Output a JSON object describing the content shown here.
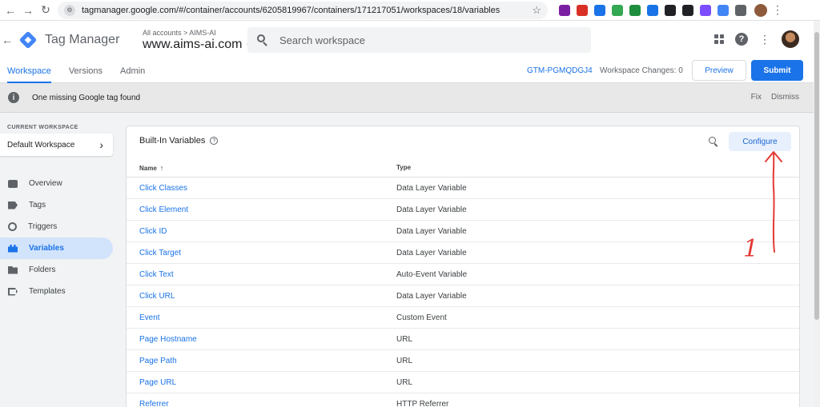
{
  "browser": {
    "url": "tagmanager.google.com/#/container/accounts/6205819967/containers/171217051/workspaces/18/variables",
    "extensions": [
      "#7b1fa2",
      "#d93025",
      "#1a73e8",
      "#34a853",
      "#1e8e3e",
      "#1a73e8",
      "#202124",
      "#202124",
      "#7c4dff",
      "#4285f4",
      "#5f6368"
    ]
  },
  "header": {
    "product_name": "Tag Manager",
    "breadcrumb": "All accounts > AIMS-AI",
    "account_name": "www.aims-ai.com",
    "search_placeholder": "Search workspace"
  },
  "tabs": {
    "workspace": "Workspace",
    "versions": "Versions",
    "admin": "Admin"
  },
  "toolbar": {
    "container_id": "GTM-PGMQDGJ4",
    "workspace_changes": "Workspace Changes: 0",
    "preview_label": "Preview",
    "submit_label": "Submit"
  },
  "notice": {
    "text": "One missing Google tag found",
    "fix_label": "Fix",
    "dismiss_label": "Dismiss"
  },
  "sidebar": {
    "current_workspace_label": "CURRENT WORKSPACE",
    "workspace_name": "Default Workspace",
    "items": [
      {
        "label": "Overview",
        "icon": "overview-icon"
      },
      {
        "label": "Tags",
        "icon": "tag-icon"
      },
      {
        "label": "Triggers",
        "icon": "trigger-icon"
      },
      {
        "label": "Variables",
        "icon": "variables-icon"
      },
      {
        "label": "Folders",
        "icon": "folder-icon"
      },
      {
        "label": "Templates",
        "icon": "template-icon"
      }
    ],
    "active_item": "Variables"
  },
  "card": {
    "title": "Built-In Variables",
    "configure_label": "Configure",
    "columns": {
      "name": "Name",
      "type": "Type"
    },
    "rows": [
      {
        "name": "Click Classes",
        "type": "Data Layer Variable"
      },
      {
        "name": "Click Element",
        "type": "Data Layer Variable"
      },
      {
        "name": "Click ID",
        "type": "Data Layer Variable"
      },
      {
        "name": "Click Target",
        "type": "Data Layer Variable"
      },
      {
        "name": "Click Text",
        "type": "Auto-Event Variable"
      },
      {
        "name": "Click URL",
        "type": "Data Layer Variable"
      },
      {
        "name": "Event",
        "type": "Custom Event"
      },
      {
        "name": "Page Hostname",
        "type": "URL"
      },
      {
        "name": "Page Path",
        "type": "URL"
      },
      {
        "name": "Page URL",
        "type": "URL"
      },
      {
        "name": "Referrer",
        "type": "HTTP Referrer"
      }
    ]
  },
  "annotation": {
    "number": "1",
    "color": "#e53935"
  }
}
